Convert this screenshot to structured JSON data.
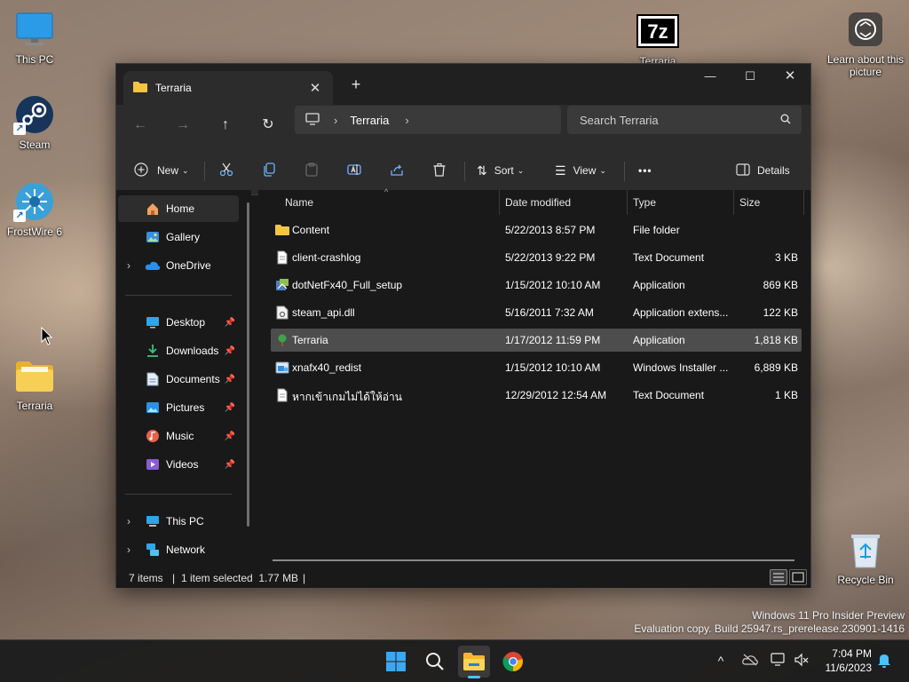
{
  "desktop": {
    "icons": [
      {
        "label": "This PC"
      },
      {
        "label": "Steam"
      },
      {
        "label": "FrostWire 6"
      },
      {
        "label": "Terraria"
      },
      {
        "label": "Terraria"
      },
      {
        "label": "Learn about this picture"
      },
      {
        "label": "Recycle Bin"
      }
    ]
  },
  "window": {
    "tab_title": "Terraria",
    "new_tab_symbol": "+",
    "controls": {
      "minimize": "—",
      "maximize": "☐",
      "close": "✕"
    }
  },
  "navbar": {
    "breadcrumb": "Terraria",
    "search_placeholder": "Search Terraria"
  },
  "toolbar": {
    "new_label": "New",
    "sort_label": "Sort",
    "view_label": "View",
    "more_label": "•••",
    "details_label": "Details"
  },
  "sidebar": {
    "items": [
      {
        "label": "Home"
      },
      {
        "label": "Gallery"
      },
      {
        "label": "OneDrive"
      },
      {
        "label": "Desktop"
      },
      {
        "label": "Downloads"
      },
      {
        "label": "Documents"
      },
      {
        "label": "Pictures"
      },
      {
        "label": "Music"
      },
      {
        "label": "Videos"
      },
      {
        "label": "This PC"
      },
      {
        "label": "Network"
      }
    ]
  },
  "filelist": {
    "columns": {
      "name": "Name",
      "date": "Date modified",
      "type": "Type",
      "size": "Size"
    },
    "rows": [
      {
        "name": "Content",
        "date": "5/22/2013 8:57 PM",
        "type": "File folder",
        "size": ""
      },
      {
        "name": "client-crashlog",
        "date": "5/22/2013 9:22 PM",
        "type": "Text Document",
        "size": "3 KB"
      },
      {
        "name": "dotNetFx40_Full_setup",
        "date": "1/15/2012 10:10 AM",
        "type": "Application",
        "size": "869 KB"
      },
      {
        "name": "steam_api.dll",
        "date": "5/16/2011 7:32 AM",
        "type": "Application extens...",
        "size": "122 KB"
      },
      {
        "name": "Terraria",
        "date": "1/17/2012 11:59 PM",
        "type": "Application",
        "size": "1,818 KB"
      },
      {
        "name": "xnafx40_redist",
        "date": "1/15/2012 10:10 AM",
        "type": "Windows Installer ...",
        "size": "6,889 KB"
      },
      {
        "name": "หากเข้าเกมไม่ได้ให้อ่าน",
        "date": "12/29/2012 12:54 AM",
        "type": "Text Document",
        "size": "1 KB"
      }
    ]
  },
  "statusbar": {
    "items_count": "7 items",
    "selection": "1 item selected  1.77 MB",
    "divider": "|"
  },
  "watermark": {
    "line1": "Windows 11 Pro Insider Preview",
    "line2": "Evaluation copy. Build 25947.rs_prerelease.230901-1416"
  },
  "taskbar": {
    "time": "7:04 PM",
    "date": "11/6/2023"
  },
  "colors": {
    "accent": "#0078d4",
    "folder_yellow": "#f4c542",
    "window_bg": "#191919",
    "toolbar_bg": "#2c2c2c"
  }
}
